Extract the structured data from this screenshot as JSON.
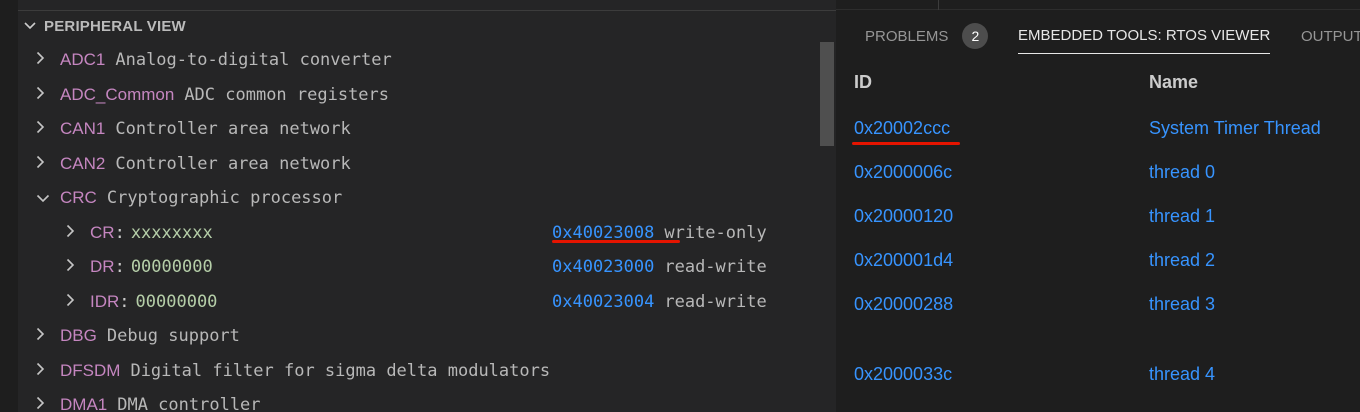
{
  "peripheral_view": {
    "section_title": "PERIPHERAL VIEW",
    "items": [
      {
        "name": "ADC1",
        "desc": "Analog-to-digital converter"
      },
      {
        "name": "ADC_Common",
        "desc": "ADC common registers"
      },
      {
        "name": "CAN1",
        "desc": "Controller area network"
      },
      {
        "name": "CAN2",
        "desc": "Controller area network"
      },
      {
        "name": "CRC",
        "desc": "Cryptographic processor"
      },
      {
        "name": "DBG",
        "desc": "Debug support"
      },
      {
        "name": "DFSDM",
        "desc": "Digital filter for sigma delta modulators"
      },
      {
        "name": "DMA1",
        "desc": "DMA controller"
      }
    ],
    "registers": [
      {
        "name": "CR",
        "value": "xxxxxxxx",
        "address": "0x40023008",
        "access": "write-only"
      },
      {
        "name": "DR",
        "value": "00000000",
        "address": "0x40023000",
        "access": "read-write"
      },
      {
        "name": "IDR",
        "value": "00000000",
        "address": "0x40023004",
        "access": "read-write"
      }
    ]
  },
  "panel": {
    "tabs": [
      {
        "label": "PROBLEMS",
        "badge": "2"
      },
      {
        "label": "EMBEDDED TOOLS: RTOS VIEWER"
      },
      {
        "label": "OUTPUT"
      }
    ],
    "columns": {
      "id": "ID",
      "name": "Name"
    },
    "threads": [
      {
        "id": "0x20002ccc",
        "name": "System Timer Thread"
      },
      {
        "id": "0x2000006c",
        "name": "thread 0"
      },
      {
        "id": "0x20000120",
        "name": "thread 1"
      },
      {
        "id": "0x200001d4",
        "name": "thread 2"
      },
      {
        "id": "0x20000288",
        "name": "thread 3"
      },
      {
        "id": "0x2000033c",
        "name": "thread 4"
      }
    ]
  },
  "icons": {
    "chevron_right": "›",
    "chevron_down": "⌄"
  },
  "colors": {
    "annotation": "#e51400",
    "link": "#3794ff",
    "peripheral_name": "#c586c0",
    "register_value": "#b5cea8"
  }
}
